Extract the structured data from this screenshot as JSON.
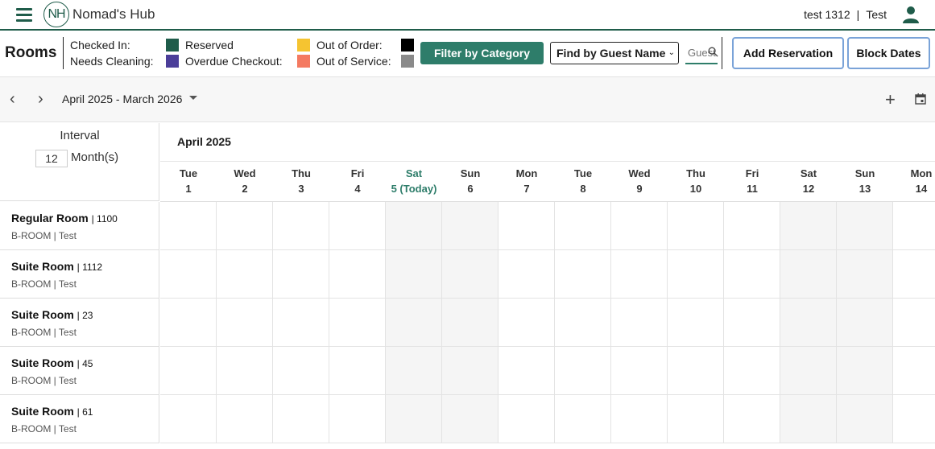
{
  "header": {
    "logo_text": "NH",
    "app_name": "Nomad's Hub",
    "user_name": "test 1312",
    "separator": "|",
    "org_name": "Test"
  },
  "toolbar": {
    "title": "Rooms",
    "legend": {
      "checked_in": "Checked In:",
      "needs_cleaning": "Needs Cleaning:",
      "reserved": "Reserved",
      "overdue_checkout": "Overdue Checkout:",
      "out_of_order": "Out of Order:",
      "out_of_service": "Out of Service:"
    },
    "legend_colors": {
      "checked_in": "#1f5c4a",
      "needs_cleaning": "#4b3e99",
      "reserved": "#f5c431",
      "overdue_checkout": "#f47a61",
      "out_of_order": "#000000",
      "out_of_service": "#8a8a8a"
    },
    "filter_button": "Filter by Category",
    "guest_select_value": "Find by Guest Name",
    "guest_input_placeholder": "Guest",
    "add_reservation": "Add Reservation",
    "block_dates": "Block Dates"
  },
  "date_nav": {
    "range": "April 2025 - March 2026",
    "add_icon": "plus-icon",
    "calendar_icon": "calendar-icon"
  },
  "interval": {
    "label": "Interval",
    "value": "12",
    "unit": "Month(s)"
  },
  "calendar": {
    "month_title": "April 2025",
    "days": [
      {
        "dow": "Tue",
        "date": "1",
        "today": false,
        "weekend": false
      },
      {
        "dow": "Wed",
        "date": "2",
        "today": false,
        "weekend": false
      },
      {
        "dow": "Thu",
        "date": "3",
        "today": false,
        "weekend": false
      },
      {
        "dow": "Fri",
        "date": "4",
        "today": false,
        "weekend": false
      },
      {
        "dow": "Sat",
        "date": "5 (Today)",
        "today": true,
        "weekend": true
      },
      {
        "dow": "Sun",
        "date": "6",
        "today": false,
        "weekend": true
      },
      {
        "dow": "Mon",
        "date": "7",
        "today": false,
        "weekend": false
      },
      {
        "dow": "Tue",
        "date": "8",
        "today": false,
        "weekend": false
      },
      {
        "dow": "Wed",
        "date": "9",
        "today": false,
        "weekend": false
      },
      {
        "dow": "Thu",
        "date": "10",
        "today": false,
        "weekend": false
      },
      {
        "dow": "Fri",
        "date": "11",
        "today": false,
        "weekend": false
      },
      {
        "dow": "Sat",
        "date": "12",
        "today": false,
        "weekend": true
      },
      {
        "dow": "Sun",
        "date": "13",
        "today": false,
        "weekend": true
      },
      {
        "dow": "Mon",
        "date": "14",
        "today": false,
        "weekend": false
      }
    ]
  },
  "rooms": [
    {
      "type": "Regular Room",
      "number": "| 1100",
      "sub": "B-ROOM | Test"
    },
    {
      "type": "Suite Room",
      "number": "| 1112",
      "sub": "B-ROOM | Test"
    },
    {
      "type": "Suite Room",
      "number": "| 23",
      "sub": "B-ROOM | Test"
    },
    {
      "type": "Suite Room",
      "number": "| 45",
      "sub": "B-ROOM | Test"
    },
    {
      "type": "Suite Room",
      "number": "| 61",
      "sub": "B-ROOM | Test"
    }
  ]
}
